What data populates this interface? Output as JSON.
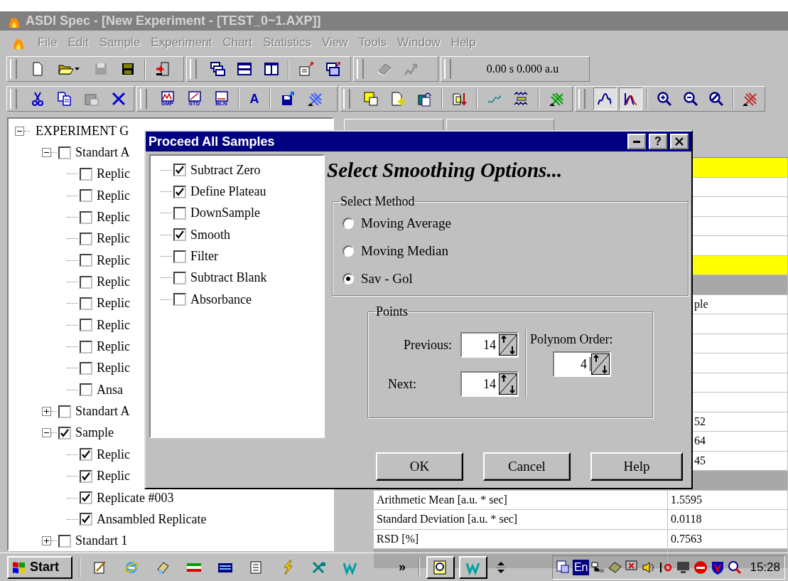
{
  "window": {
    "title": "ASDI Spec - [New Experiment - [TEST_0~1.AXP]]"
  },
  "menu": [
    {
      "label": "File",
      "disabled": true
    },
    {
      "label": "Edit",
      "disabled": true
    },
    {
      "label": "Sample",
      "disabled": true
    },
    {
      "label": "Experiment",
      "disabled": true
    },
    {
      "label": "Chart",
      "disabled": true
    },
    {
      "label": "Statistics",
      "disabled": true
    },
    {
      "label": "View",
      "disabled": true
    },
    {
      "label": "Tools",
      "disabled": true
    },
    {
      "label": "Window",
      "disabled": true
    },
    {
      "label": "Help",
      "disabled": true
    }
  ],
  "toolbar": {
    "readout": "0.00 s 0.000 a.u",
    "tool_labels": [
      "SMP",
      "STD",
      "BLN"
    ],
    "font_button": "A",
    "view_buttons": [
      {
        "selected": true
      },
      {
        "selected": true
      }
    ]
  },
  "tree": {
    "label": "EXPERIMENT G",
    "expanded": true,
    "children": [
      {
        "label": "Standart A",
        "checked": false,
        "expanded": true,
        "children": [
          {
            "label": "Replic",
            "checked": false
          },
          {
            "label": "Replic",
            "checked": false
          },
          {
            "label": "Replic",
            "checked": false
          },
          {
            "label": "Replic",
            "checked": false
          },
          {
            "label": "Replic",
            "checked": false
          },
          {
            "label": "Replic",
            "checked": false
          },
          {
            "label": "Replic",
            "checked": false
          },
          {
            "label": "Replic",
            "checked": false
          },
          {
            "label": "Replic",
            "checked": false
          },
          {
            "label": "Replic",
            "checked": false
          },
          {
            "label": "Ansa",
            "checked": false
          }
        ]
      },
      {
        "label": "Standart A",
        "checked": false,
        "expanded": false
      },
      {
        "label": "Sample",
        "checked": true,
        "expanded": true,
        "children": [
          {
            "label": "Replic",
            "checked": true
          },
          {
            "label": "Replic",
            "checked": true
          },
          {
            "label": "Replicate #003",
            "checked": true
          },
          {
            "label": "Ansambled Replicate",
            "checked": true
          }
        ]
      },
      {
        "label": "Standart 1",
        "checked": false,
        "expanded": false
      }
    ]
  },
  "statistics_table": {
    "rows": [
      {
        "kind": "highlight"
      },
      {
        "kind": "plain"
      },
      {
        "kind": "plain"
      },
      {
        "kind": "plain"
      },
      {
        "kind": "plain"
      },
      {
        "kind": "highlight"
      },
      {
        "kind": "header"
      },
      {
        "kind": "split",
        "column_2": "ple"
      },
      {
        "kind": "plain"
      },
      {
        "kind": "plain"
      },
      {
        "kind": "plain"
      },
      {
        "kind": "plain"
      },
      {
        "kind": "plain"
      },
      {
        "kind": "split",
        "column_2": "52"
      },
      {
        "kind": "split",
        "column_2": "64"
      },
      {
        "kind": "split",
        "column_2": "45"
      },
      {
        "kind": "header"
      },
      {
        "kind": "plain",
        "column_1": "Arithmetic Mean [a.u. * sec]",
        "column_2": "1.5595"
      },
      {
        "kind": "plain",
        "column_1": "Standard Deviation [a.u. * sec]",
        "column_2": "0.0118"
      },
      {
        "kind": "plain",
        "column_1": "RSD [%]",
        "column_2": "0.7563"
      },
      {
        "kind": "header"
      }
    ]
  },
  "dialog": {
    "title": "Proceed All Samples",
    "help_button": "?",
    "steps": [
      {
        "label": "Subtract Zero",
        "checked": true
      },
      {
        "label": "Define Plateau",
        "checked": true
      },
      {
        "label": "DownSample",
        "checked": false
      },
      {
        "label": "Smooth",
        "checked": true
      },
      {
        "label": "Filter",
        "checked": false
      },
      {
        "label": "Subtract Blank",
        "checked": false
      },
      {
        "label": "Absorbance",
        "checked": false
      }
    ],
    "heading": "Select Smoothing Options...",
    "method_group": {
      "legend": "Select Method",
      "options": [
        {
          "label": "Moving Average",
          "selected": false
        },
        {
          "label": "Moving Median",
          "selected": false
        },
        {
          "label": "Sav - Gol",
          "selected": true
        }
      ]
    },
    "points_group": {
      "legend": "Points",
      "previous": {
        "label": "Previous:",
        "value": "14"
      },
      "next": {
        "label": "Next:",
        "value": "14"
      },
      "polynom_order": {
        "label": "Polynom Order:",
        "value": "4"
      }
    },
    "buttons": [
      "OK",
      "Cancel",
      "Help"
    ]
  },
  "taskbar": {
    "start": "Start",
    "more": "»",
    "language": "En",
    "clock": "15:28"
  }
}
